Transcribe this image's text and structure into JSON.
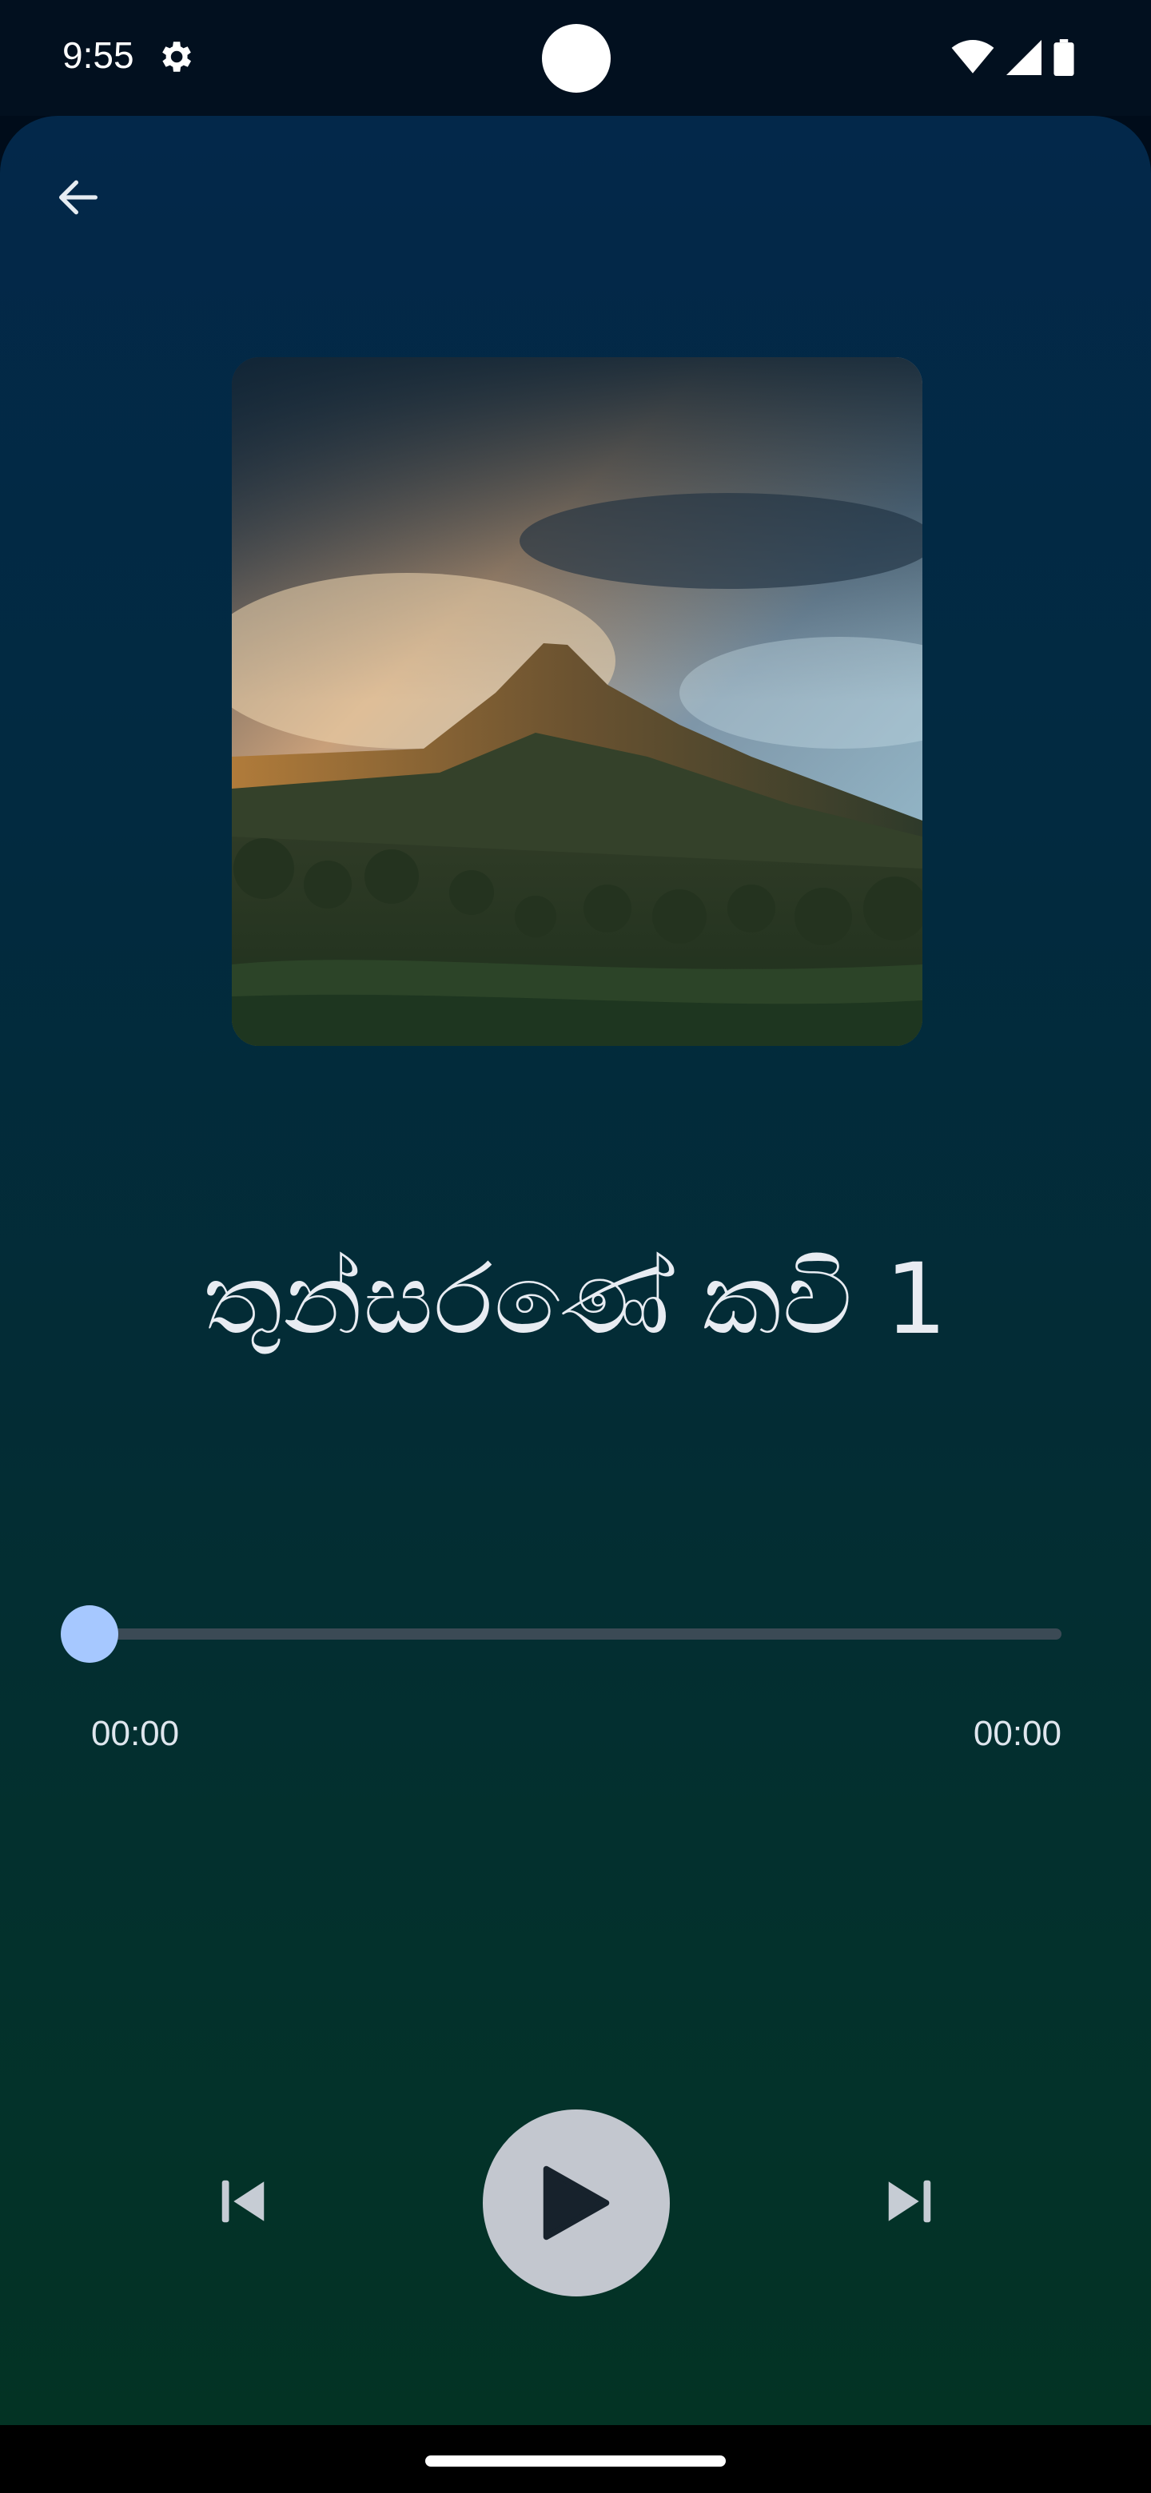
{
  "status_bar": {
    "time": "9:55",
    "icons": [
      "settings-gear-icon",
      "wifi-icon",
      "cellular-signal-icon",
      "battery-icon"
    ]
  },
  "player": {
    "back_icon": "arrow-left-icon",
    "artwork": "mountain-peak-landscape",
    "title": "තුන්සරණේ කවි 1",
    "progress": 0,
    "time_current": "00:00",
    "time_total": "00:00",
    "controls": {
      "previous_icon": "skip-previous-icon",
      "play_icon": "play-icon",
      "next_icon": "skip-next-icon"
    }
  },
  "colors": {
    "accent": "#a6c8ff",
    "play_button": "#c3c7cf",
    "text": "#e8ecf2"
  }
}
